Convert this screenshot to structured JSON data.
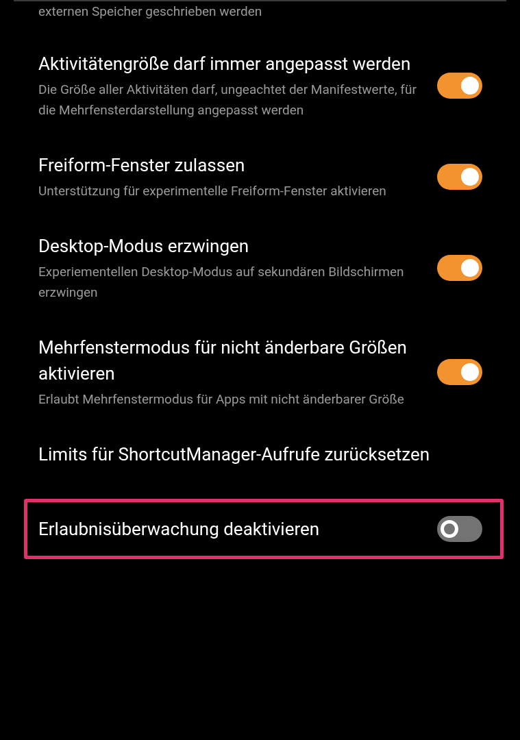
{
  "top_text": "externen Speicher geschrieben werden",
  "settings": [
    {
      "kind": "toggle",
      "title": "Aktivitätengröße darf immer angepasst werden",
      "description": "Die Größe aller Aktivitäten darf, ungeachtet der Manifestwerte, für die Mehrfensterdarstellung angepasst werden",
      "on": true,
      "highlighted": false
    },
    {
      "kind": "toggle",
      "title": "Freiform-Fenster zulassen",
      "description": "Unterstützung für experimentelle Freiform-Fenster aktivieren",
      "on": true,
      "highlighted": false
    },
    {
      "kind": "toggle",
      "title": "Desktop-Modus erzwingen",
      "description": "Experiementellen Desktop-Modus auf sekundären Bildschirmen erzwingen",
      "on": true,
      "highlighted": false
    },
    {
      "kind": "toggle",
      "title": "Mehrfenstermodus für nicht änderbare Größen aktivieren",
      "description": "Erlaubt Mehrfenstermodus für Apps mit nicht änderbarer Größe",
      "on": true,
      "highlighted": false
    },
    {
      "kind": "action",
      "title": "Limits für ShortcutManager-Aufrufe zurücksetzen",
      "highlighted": false
    },
    {
      "kind": "toggle",
      "title": "Erlaubnisüberwachung deaktivieren",
      "on": false,
      "highlighted": true
    }
  ]
}
